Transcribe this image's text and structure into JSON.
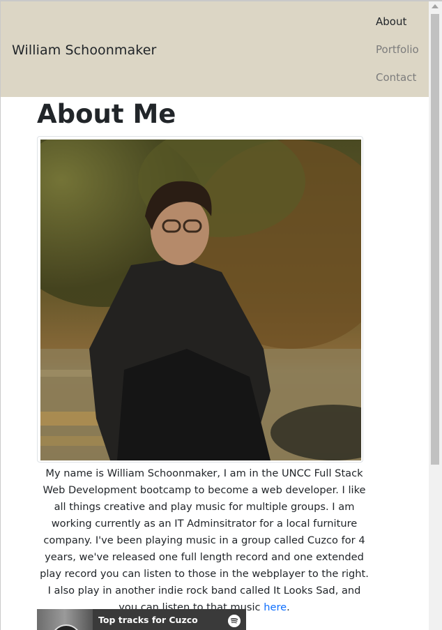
{
  "navbar": {
    "brand": "William Schoonmaker",
    "links": [
      {
        "label": "About",
        "active": true
      },
      {
        "label": "Portfolio",
        "active": false
      },
      {
        "label": "Contact",
        "active": false
      }
    ]
  },
  "main": {
    "heading": "About Me",
    "bio_text": "My name is William Schoonmaker, I am in the UNCC Full Stack Web Development bootcamp to become a web developer. I like all things creative and play music for multiple groups. I am working currently as an IT Adminsitrator for a local furniture company. I've been playing music in a group called Cuzco for 4 years, we've released one full length record and one extended play record you can listen to those in the webplayer to the right. I also play in another indie rock band called It Looks Sad, and you can listen to that music",
    "bio_link": "here",
    "bio_end": "."
  },
  "spotify_widget": {
    "title": "Top tracks for Cuzco",
    "icon": "spotify-icon"
  },
  "colors": {
    "navbar_bg": "#dcd6c5",
    "link": "#0d6efd",
    "muted_nav": "#7c7c7c"
  }
}
